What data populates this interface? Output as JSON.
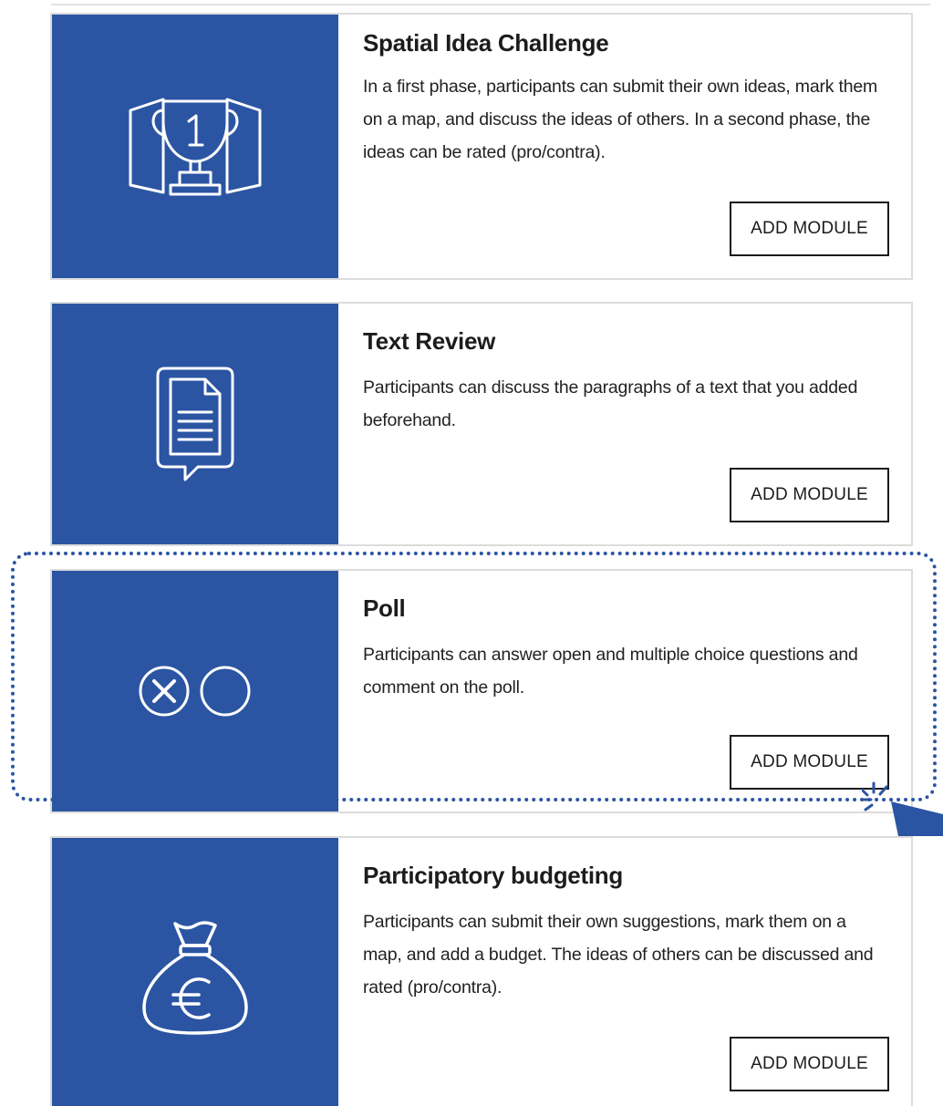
{
  "modules": [
    {
      "title": "Spatial Idea Challenge",
      "description": "In a first phase, participants can submit their own ideas, mark them on a map, and discuss the ideas of others. In a second phase, the ideas can be rated (pro/contra).",
      "button_label": "ADD MODULE",
      "icon": "trophy-map-icon"
    },
    {
      "title": "Text Review",
      "description": "Participants can discuss the paragraphs of a text that you added beforehand.",
      "button_label": "ADD MODULE",
      "icon": "document-speech-bubble-icon"
    },
    {
      "title": "Poll",
      "description": "Participants can answer open and multiple choice questions and comment on the poll.",
      "button_label": "ADD MODULE",
      "icon": "poll-choices-icon"
    },
    {
      "title": "Participatory budgeting",
      "description": "Participants can submit their own suggestions, mark them on a map, and add a budget. The ideas of others can be discussed and rated (pro/contra).",
      "button_label": "ADD MODULE",
      "icon": "money-bag-euro-icon"
    }
  ],
  "colors": {
    "module_image_background": "#2b55a3",
    "highlight_border": "#2b55a3",
    "button_border": "#1b1b1b",
    "card_border": "#dcdcdc"
  },
  "highlighted_module": "Poll"
}
